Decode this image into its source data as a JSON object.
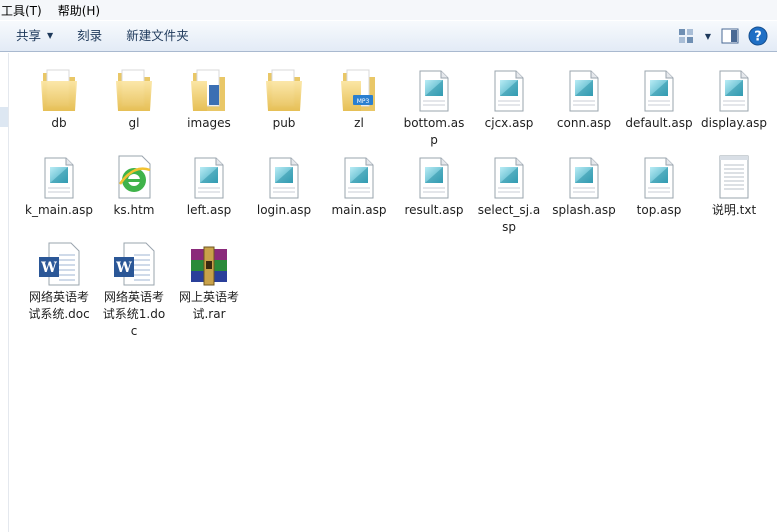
{
  "menu": {
    "tools": "工具(T)",
    "help": "帮助(H)"
  },
  "toolbar": {
    "share": "共享",
    "burn": "刻录",
    "new_folder": "新建文件夹"
  },
  "files": [
    {
      "name": "db",
      "type": "folder"
    },
    {
      "name": "gl",
      "type": "folder"
    },
    {
      "name": "images",
      "type": "folder-images"
    },
    {
      "name": "pub",
      "type": "folder"
    },
    {
      "name": "zl",
      "type": "folder-mp3"
    },
    {
      "name": "bottom.asp",
      "type": "asp"
    },
    {
      "name": "cjcx.asp",
      "type": "asp"
    },
    {
      "name": "conn.asp",
      "type": "asp"
    },
    {
      "name": "default.asp",
      "type": "asp"
    },
    {
      "name": "display.asp",
      "type": "asp"
    },
    {
      "name": "k_main.asp",
      "type": "asp"
    },
    {
      "name": "ks.htm",
      "type": "htm"
    },
    {
      "name": "left.asp",
      "type": "asp"
    },
    {
      "name": "login.asp",
      "type": "asp"
    },
    {
      "name": "main.asp",
      "type": "asp"
    },
    {
      "name": "result.asp",
      "type": "asp"
    },
    {
      "name": "select_sj.asp",
      "type": "asp"
    },
    {
      "name": "splash.asp",
      "type": "asp"
    },
    {
      "name": "top.asp",
      "type": "asp"
    },
    {
      "name": "说明.txt",
      "type": "txt"
    },
    {
      "name": "网络英语考试系统.doc",
      "type": "doc"
    },
    {
      "name": "网络英语考试系统1.doc",
      "type": "doc"
    },
    {
      "name": "网上英语考试.rar",
      "type": "rar"
    }
  ],
  "icons": {
    "folder": "folder-icon",
    "asp": "asp-file-icon",
    "htm": "ie-html-icon",
    "txt": "text-file-icon",
    "doc": "word-doc-icon",
    "rar": "winrar-archive-icon",
    "view": "view-options-icon",
    "preview": "preview-pane-icon",
    "help": "help-icon"
  },
  "colors": {
    "toolbar_text": "#1e395b",
    "folder": "#f2d37a",
    "asp_accent": "#5ac3d6",
    "help_blue": "#1f6fc5"
  }
}
